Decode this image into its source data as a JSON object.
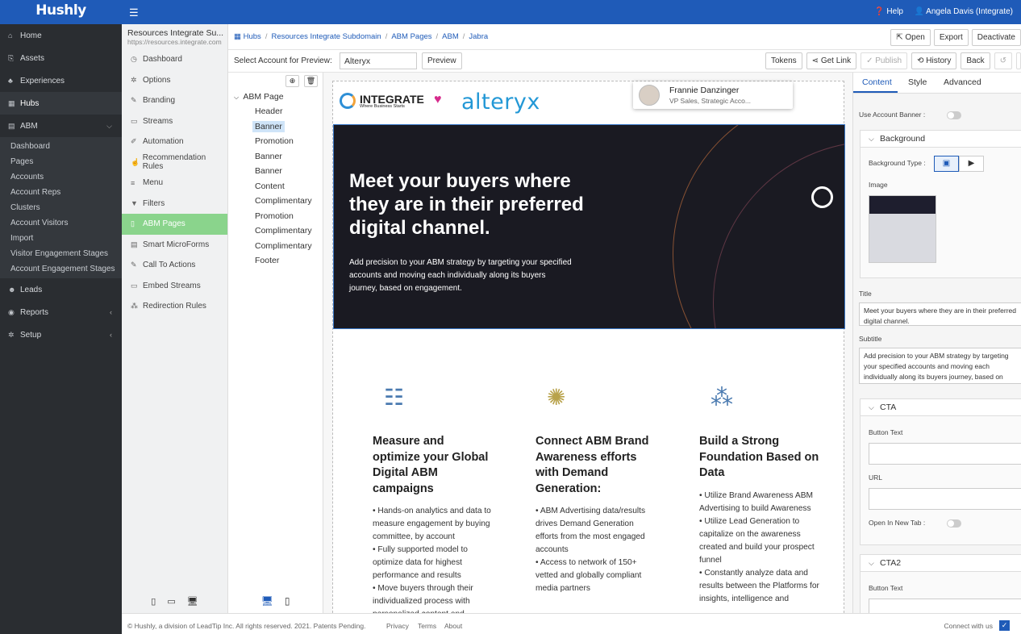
{
  "app": {
    "logo": "Hushly"
  },
  "topbar": {
    "help": "Help",
    "user": "Angela Davis (Integrate)"
  },
  "sidebar": {
    "items": [
      {
        "label": "Home",
        "icon": "home-icon",
        "glyph": "⌂"
      },
      {
        "label": "Assets",
        "icon": "assets-icon",
        "glyph": "⎘"
      },
      {
        "label": "Experiences",
        "icon": "experiences-icon",
        "glyph": "♣"
      },
      {
        "label": "Hubs",
        "icon": "hubs-icon",
        "glyph": "▦"
      },
      {
        "label": "ABM",
        "icon": "abm-icon",
        "glyph": "▤"
      }
    ],
    "abm_sub": [
      "Dashboard",
      "Pages",
      "Accounts",
      "Account Reps",
      "Clusters",
      "Account Visitors",
      "Import",
      "Visitor Engagement Stages",
      "Account Engagement Stages"
    ],
    "lower_items": [
      {
        "label": "Leads",
        "icon": "leads-icon",
        "glyph": "☻"
      },
      {
        "label": "Reports",
        "icon": "reports-icon",
        "glyph": "◉"
      },
      {
        "label": "Setup",
        "icon": "setup-icon",
        "glyph": "✲"
      }
    ]
  },
  "hub_panel": {
    "title": "Resources Integrate Su...",
    "url": "https://resources.integrate.com",
    "items": [
      {
        "label": "Dashboard",
        "glyph": "◷"
      },
      {
        "label": "Options",
        "glyph": "✲"
      },
      {
        "label": "Branding",
        "glyph": "✎"
      },
      {
        "label": "Streams",
        "glyph": "▭"
      },
      {
        "label": "Automation",
        "glyph": "✐"
      },
      {
        "label": "Recommendation Rules",
        "glyph": "☝"
      },
      {
        "label": "Menu",
        "glyph": "≡"
      },
      {
        "label": "Filters",
        "glyph": "▼"
      },
      {
        "label": "ABM Pages",
        "glyph": "▯"
      },
      {
        "label": "Smart MicroForms",
        "glyph": "▤"
      },
      {
        "label": "Call To Actions",
        "glyph": "✎"
      },
      {
        "label": "Embed Streams",
        "glyph": "▭"
      },
      {
        "label": "Redirection Rules",
        "glyph": "⁂"
      }
    ]
  },
  "breadcrumb": [
    "Hubs",
    "Resources Integrate Subdomain",
    "ABM Pages",
    "ABM",
    "Jabra"
  ],
  "top_buttons": [
    "Open",
    "Export",
    "Deactivate"
  ],
  "toolbar": {
    "label": "Select Account for Preview:",
    "account_value": "Alteryx",
    "preview": "Preview",
    "tokens": "Tokens",
    "get_link": "Get Link",
    "publish": "Publish",
    "history": "History",
    "back": "Back"
  },
  "tree": {
    "root": "ABM Page",
    "nodes": [
      "Header",
      "Banner",
      "Promotion",
      "Banner",
      "Banner",
      "Content",
      "Complimentary",
      "Promotion",
      "Complimentary",
      "Complimentary",
      "Footer"
    ],
    "selected_index": 1
  },
  "preview": {
    "brand": "INTEGRATE",
    "brand_tag": "Where Business Starts",
    "partner": "alteryx",
    "person_name": "Frannie Danzinger",
    "person_role": "VP Sales, Strategic Acco...",
    "banner_title": "Meet your buyers where they are in their preferred digital channel.",
    "banner_subtitle": "Add precision to your ABM strategy by targeting your specified accounts and moving each individually along its buyers journey, based on engagement.",
    "columns": [
      {
        "icon": "hierarchy-icon",
        "glyph": "☷",
        "title": "Measure and optimize your Global Digital ABM campaigns",
        "body": "• Hands-on analytics and data to measure engagement by buying committee, by account\n• Fully supported model to optimize data for highest performance and results\n• Move buyers through their individualized process with personalized content and"
      },
      {
        "icon": "network-icon",
        "glyph": "✺",
        "title": "Connect ABM Brand Awareness efforts with Demand Generation:",
        "body": "• ABM Advertising data/results drives Demand Generation efforts from the most engaged accounts\n• Access to network of 150+ vetted and globally compliant media partners"
      },
      {
        "icon": "pyramid-icon",
        "glyph": "⁂",
        "title": "Build a Strong Foundation Based on Data",
        "body": "• Utilize Brand Awareness ABM Advertising to build Awareness\n• Utilize Lead Generation to capitalize on the awareness created and build your prospect funnel\n• Constantly analyze data and results between the Platforms for insights, intelligence and"
      }
    ]
  },
  "props": {
    "tabs": [
      "Content",
      "Style",
      "Advanced"
    ],
    "use_account_banner": "Use Account Banner :",
    "background_section": "Background",
    "background_type": "Background Type :",
    "image": "Image",
    "title_label": "Title",
    "title_value": "Meet your buyers where they are in their preferred digital channel.",
    "subtitle_label": "Subtitle",
    "subtitle_value": "Add precision to your ABM strategy by targeting your specified accounts and moving each individually along its buyers journey, based on engagement.",
    "cta_section": "CTA",
    "button_text": "Button Text",
    "url": "URL",
    "open_new_tab": "Open In New Tab :",
    "cta2_section": "CTA2",
    "button_text2": "Button Text"
  },
  "footer": {
    "copyright": "© Hushly, a division of LeadTip Inc. All rights reserved. 2021. Patents Pending.",
    "privacy": "Privacy",
    "terms": "Terms",
    "about": "About",
    "connect": "Connect with us"
  },
  "colors": {
    "brand_blue": "#1f5bb8",
    "active_green": "#8ad48c",
    "sidebar_dark": "#2a2d31"
  }
}
